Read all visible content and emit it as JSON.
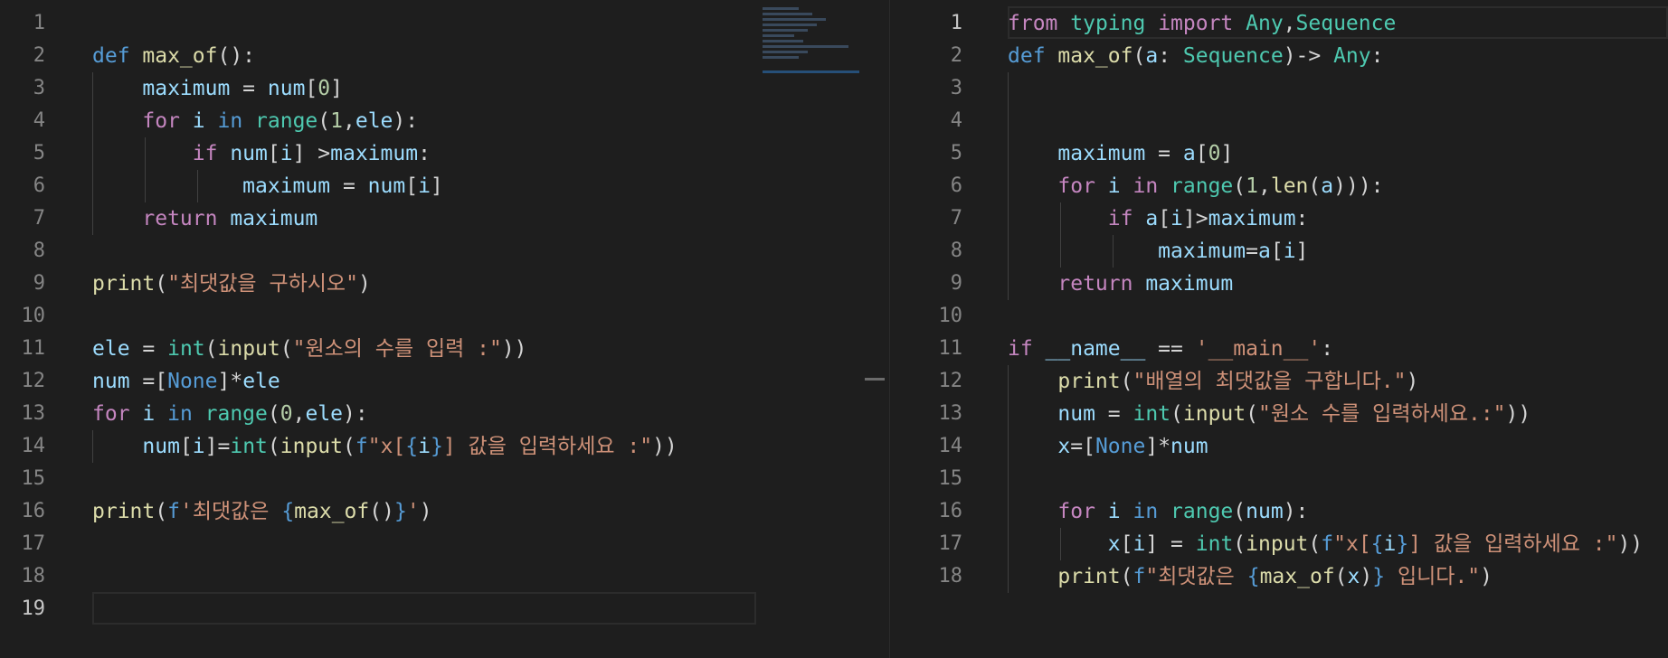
{
  "editor": {
    "colors": {
      "background": "#1e1e1e",
      "line_number": "#858585",
      "line_number_active": "#c6c6c6",
      "keyword": "#c586c0",
      "storage": "#569cd6",
      "function": "#dcdcaa",
      "variable": "#9cdcfe",
      "number": "#b5cea8",
      "string": "#ce9178",
      "type": "#4ec9b0"
    },
    "left_pane": {
      "active_line": 19,
      "lines": [
        {
          "n": "1",
          "tokens": []
        },
        {
          "n": "2",
          "tokens": [
            [
              "t-def",
              "def "
            ],
            [
              "t-fn",
              "max_of"
            ],
            [
              "t-op",
              "():"
            ]
          ]
        },
        {
          "n": "3",
          "tokens": [
            [
              "t-op",
              "    "
            ],
            [
              "t-var",
              "maximum"
            ],
            [
              "t-op",
              " = "
            ],
            [
              "t-var",
              "num"
            ],
            [
              "t-op",
              "["
            ],
            [
              "t-num",
              "0"
            ],
            [
              "t-op",
              "]"
            ]
          ]
        },
        {
          "n": "4",
          "tokens": [
            [
              "t-op",
              "    "
            ],
            [
              "t-kw",
              "for "
            ],
            [
              "t-var",
              "i"
            ],
            [
              "t-def",
              " in "
            ],
            [
              "t-cls",
              "range"
            ],
            [
              "t-op",
              "("
            ],
            [
              "t-num",
              "1"
            ],
            [
              "t-op",
              ","
            ],
            [
              "t-var",
              "ele"
            ],
            [
              "t-op",
              "):"
            ]
          ]
        },
        {
          "n": "5",
          "tokens": [
            [
              "t-op",
              "        "
            ],
            [
              "t-kw",
              "if "
            ],
            [
              "t-var",
              "num"
            ],
            [
              "t-op",
              "["
            ],
            [
              "t-var",
              "i"
            ],
            [
              "t-op",
              "] >"
            ],
            [
              "t-var",
              "maximum"
            ],
            [
              "t-op",
              ":"
            ]
          ]
        },
        {
          "n": "6",
          "tokens": [
            [
              "t-op",
              "            "
            ],
            [
              "t-var",
              "maximum"
            ],
            [
              "t-op",
              " = "
            ],
            [
              "t-var",
              "num"
            ],
            [
              "t-op",
              "["
            ],
            [
              "t-var",
              "i"
            ],
            [
              "t-op",
              "]"
            ]
          ]
        },
        {
          "n": "7",
          "tokens": [
            [
              "t-op",
              "    "
            ],
            [
              "t-kw",
              "return "
            ],
            [
              "t-var",
              "maximum"
            ]
          ]
        },
        {
          "n": "8",
          "tokens": []
        },
        {
          "n": "9",
          "tokens": [
            [
              "t-fn",
              "print"
            ],
            [
              "t-op",
              "("
            ],
            [
              "t-str",
              "\"최댓값을 구하시오\""
            ],
            [
              "t-op",
              ")"
            ]
          ]
        },
        {
          "n": "10",
          "tokens": []
        },
        {
          "n": "11",
          "tokens": [
            [
              "t-var",
              "ele"
            ],
            [
              "t-op",
              " = "
            ],
            [
              "t-cls",
              "int"
            ],
            [
              "t-op",
              "("
            ],
            [
              "t-fn",
              "input"
            ],
            [
              "t-op",
              "("
            ],
            [
              "t-str",
              "\"원소의 수를 입력 :\""
            ],
            [
              "t-op",
              "))"
            ]
          ]
        },
        {
          "n": "12",
          "tokens": [
            [
              "t-var",
              "num"
            ],
            [
              "t-op",
              " =["
            ],
            [
              "t-kc",
              "None"
            ],
            [
              "t-op",
              "]*"
            ],
            [
              "t-var",
              "ele"
            ]
          ]
        },
        {
          "n": "13",
          "tokens": [
            [
              "t-kw",
              "for "
            ],
            [
              "t-var",
              "i"
            ],
            [
              "t-def",
              " in "
            ],
            [
              "t-cls",
              "range"
            ],
            [
              "t-op",
              "("
            ],
            [
              "t-num",
              "0"
            ],
            [
              "t-op",
              ","
            ],
            [
              "t-var",
              "ele"
            ],
            [
              "t-op",
              "):"
            ]
          ]
        },
        {
          "n": "14",
          "tokens": [
            [
              "t-op",
              "    "
            ],
            [
              "t-var",
              "num"
            ],
            [
              "t-op",
              "["
            ],
            [
              "t-var",
              "i"
            ],
            [
              "t-op",
              "]="
            ],
            [
              "t-cls",
              "int"
            ],
            [
              "t-op",
              "("
            ],
            [
              "t-fn",
              "input"
            ],
            [
              "t-op",
              "("
            ],
            [
              "t-def",
              "f"
            ],
            [
              "t-str",
              "\"x["
            ],
            [
              "t-def",
              "{"
            ],
            [
              "t-var",
              "i"
            ],
            [
              "t-def",
              "}"
            ],
            [
              "t-str",
              "] 값을 입력하세요 :\""
            ],
            [
              "t-op",
              "))"
            ]
          ]
        },
        {
          "n": "15",
          "tokens": []
        },
        {
          "n": "16",
          "tokens": [
            [
              "t-fn",
              "print"
            ],
            [
              "t-op",
              "("
            ],
            [
              "t-def",
              "f"
            ],
            [
              "t-str",
              "'최댓값은 "
            ],
            [
              "t-def",
              "{"
            ],
            [
              "t-fn",
              "max_of"
            ],
            [
              "t-op",
              "()"
            ],
            [
              "t-def",
              "}"
            ],
            [
              "t-str",
              "'"
            ],
            [
              "t-op",
              ")"
            ]
          ]
        },
        {
          "n": "17",
          "tokens": []
        },
        {
          "n": "18",
          "tokens": []
        },
        {
          "n": "19",
          "tokens": []
        }
      ]
    },
    "right_pane": {
      "active_line": 1,
      "lines": [
        {
          "n": "1",
          "tokens": [
            [
              "t-kw",
              "from "
            ],
            [
              "t-cls",
              "typing"
            ],
            [
              "t-kw",
              " import "
            ],
            [
              "t-cls",
              "Any"
            ],
            [
              "t-op",
              ","
            ],
            [
              "t-cls",
              "Sequence"
            ]
          ]
        },
        {
          "n": "2",
          "tokens": [
            [
              "t-def",
              "def "
            ],
            [
              "t-fn",
              "max_of"
            ],
            [
              "t-op",
              "("
            ],
            [
              "t-var",
              "a"
            ],
            [
              "t-op",
              ": "
            ],
            [
              "t-cls",
              "Sequence"
            ],
            [
              "t-op",
              ")-> "
            ],
            [
              "t-cls",
              "Any"
            ],
            [
              "t-op",
              ":"
            ]
          ]
        },
        {
          "n": "3",
          "tokens": []
        },
        {
          "n": "4",
          "tokens": []
        },
        {
          "n": "5",
          "tokens": [
            [
              "t-op",
              "    "
            ],
            [
              "t-var",
              "maximum"
            ],
            [
              "t-op",
              " = "
            ],
            [
              "t-var",
              "a"
            ],
            [
              "t-op",
              "["
            ],
            [
              "t-num",
              "0"
            ],
            [
              "t-op",
              "]"
            ]
          ]
        },
        {
          "n": "6",
          "tokens": [
            [
              "t-op",
              "    "
            ],
            [
              "t-kw",
              "for "
            ],
            [
              "t-var",
              "i"
            ],
            [
              "t-kw",
              " in "
            ],
            [
              "t-cls",
              "range"
            ],
            [
              "t-op",
              "("
            ],
            [
              "t-num",
              "1"
            ],
            [
              "t-op",
              ","
            ],
            [
              "t-fn",
              "len"
            ],
            [
              "t-op",
              "("
            ],
            [
              "t-var",
              "a"
            ],
            [
              "t-op",
              "))):"
            ]
          ]
        },
        {
          "n": "7",
          "tokens": [
            [
              "t-op",
              "        "
            ],
            [
              "t-kw",
              "if "
            ],
            [
              "t-var",
              "a"
            ],
            [
              "t-op",
              "["
            ],
            [
              "t-var",
              "i"
            ],
            [
              "t-op",
              "]>"
            ],
            [
              "t-var",
              "maximum"
            ],
            [
              "t-op",
              ":"
            ]
          ]
        },
        {
          "n": "8",
          "tokens": [
            [
              "t-op",
              "            "
            ],
            [
              "t-var",
              "maximum"
            ],
            [
              "t-op",
              "="
            ],
            [
              "t-var",
              "a"
            ],
            [
              "t-op",
              "["
            ],
            [
              "t-var",
              "i"
            ],
            [
              "t-op",
              "]"
            ]
          ]
        },
        {
          "n": "9",
          "tokens": [
            [
              "t-op",
              "    "
            ],
            [
              "t-kw",
              "return "
            ],
            [
              "t-var",
              "maximum"
            ]
          ]
        },
        {
          "n": "10",
          "tokens": []
        },
        {
          "n": "11",
          "tokens": [
            [
              "t-kw",
              "if "
            ],
            [
              "t-var",
              "__name__"
            ],
            [
              "t-op",
              " == "
            ],
            [
              "t-str",
              "'__main__'"
            ],
            [
              "t-op",
              ":"
            ]
          ]
        },
        {
          "n": "12",
          "tokens": [
            [
              "t-op",
              "    "
            ],
            [
              "t-fn",
              "print"
            ],
            [
              "t-op",
              "("
            ],
            [
              "t-str",
              "\"배열의 최댓값을 구합니다.\""
            ],
            [
              "t-op",
              ")"
            ]
          ]
        },
        {
          "n": "13",
          "tokens": [
            [
              "t-op",
              "    "
            ],
            [
              "t-var",
              "num"
            ],
            [
              "t-op",
              " = "
            ],
            [
              "t-cls",
              "int"
            ],
            [
              "t-op",
              "("
            ],
            [
              "t-fn",
              "input"
            ],
            [
              "t-op",
              "("
            ],
            [
              "t-str",
              "\"원소 수를 입력하세요.:\""
            ],
            [
              "t-op",
              "))"
            ]
          ]
        },
        {
          "n": "14",
          "tokens": [
            [
              "t-op",
              "    "
            ],
            [
              "t-var",
              "x"
            ],
            [
              "t-op",
              "=["
            ],
            [
              "t-kc",
              "None"
            ],
            [
              "t-op",
              "]*"
            ],
            [
              "t-var",
              "num"
            ]
          ]
        },
        {
          "n": "15",
          "tokens": []
        },
        {
          "n": "16",
          "tokens": [
            [
              "t-op",
              "    "
            ],
            [
              "t-kw",
              "for "
            ],
            [
              "t-var",
              "i"
            ],
            [
              "t-def",
              " in "
            ],
            [
              "t-cls",
              "range"
            ],
            [
              "t-op",
              "("
            ],
            [
              "t-var",
              "num"
            ],
            [
              "t-op",
              "):"
            ]
          ]
        },
        {
          "n": "17",
          "tokens": [
            [
              "t-op",
              "        "
            ],
            [
              "t-var",
              "x"
            ],
            [
              "t-op",
              "["
            ],
            [
              "t-var",
              "i"
            ],
            [
              "t-op",
              "] = "
            ],
            [
              "t-cls",
              "int"
            ],
            [
              "t-op",
              "("
            ],
            [
              "t-fn",
              "input"
            ],
            [
              "t-op",
              "("
            ],
            [
              "t-def",
              "f"
            ],
            [
              "t-str",
              "\"x["
            ],
            [
              "t-def",
              "{"
            ],
            [
              "t-var",
              "i"
            ],
            [
              "t-def",
              "}"
            ],
            [
              "t-str",
              "] 값을 입력하세요 :\""
            ],
            [
              "t-op",
              "))"
            ]
          ]
        },
        {
          "n": "18",
          "tokens": [
            [
              "t-op",
              "    "
            ],
            [
              "t-fn",
              "print"
            ],
            [
              "t-op",
              "("
            ],
            [
              "t-def",
              "f"
            ],
            [
              "t-str",
              "\"최댓값은 "
            ],
            [
              "t-def",
              "{"
            ],
            [
              "t-fn",
              "max_of"
            ],
            [
              "t-op",
              "("
            ],
            [
              "t-var",
              "x"
            ],
            [
              "t-op",
              ")"
            ],
            [
              "t-def",
              "}"
            ],
            [
              "t-str",
              " 입니다.\""
            ],
            [
              "t-op",
              ")"
            ]
          ]
        }
      ]
    }
  }
}
